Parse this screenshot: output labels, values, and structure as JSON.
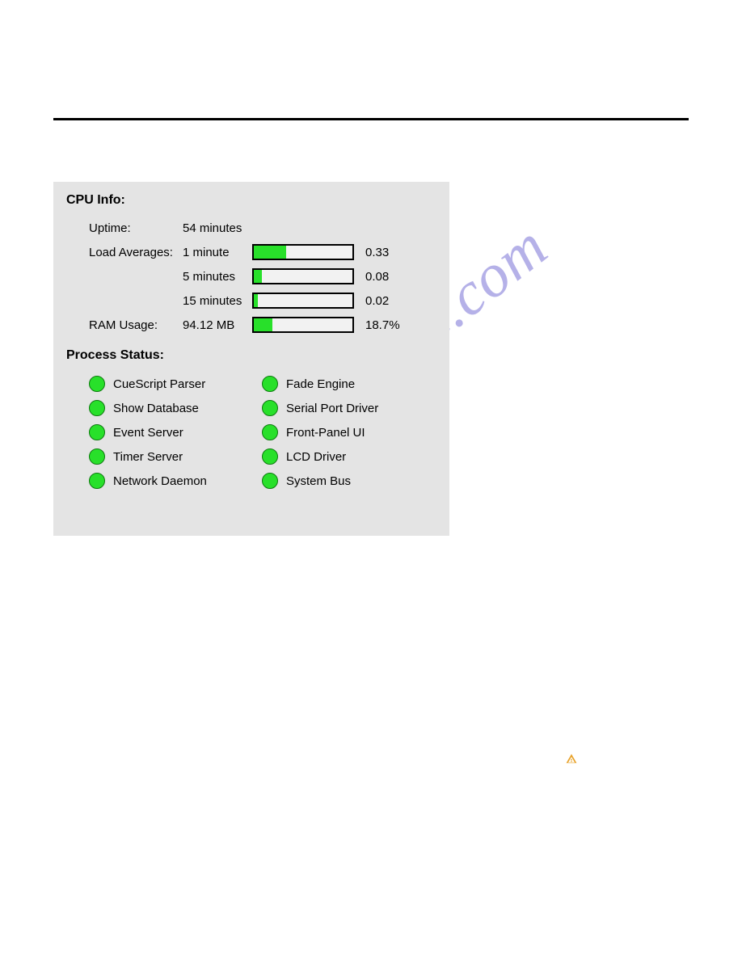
{
  "cpu_info": {
    "heading": "CPU Info:",
    "uptime_label": "Uptime:",
    "uptime_value": "54 minutes",
    "load_label": "Load Averages:",
    "loads": [
      {
        "label": "1 minute",
        "value": "0.33",
        "pct": 33
      },
      {
        "label": "5 minutes",
        "value": "0.08",
        "pct": 8
      },
      {
        "label": "15 minutes",
        "value": "0.02",
        "pct": 4
      }
    ],
    "ram_label": "RAM Usage:",
    "ram_value": "94.12 MB",
    "ram_pct_label": "18.7%",
    "ram_pct": 18.7
  },
  "process_status": {
    "heading": "Process Status:",
    "left": [
      "CueScript Parser",
      "Show Database",
      "Event Server",
      "Timer Server",
      "Network Daemon"
    ],
    "right": [
      "Fade Engine",
      "Serial Port Driver",
      "Front-Panel UI",
      "LCD Driver",
      "System Bus"
    ]
  },
  "watermark": "manualshive.com"
}
